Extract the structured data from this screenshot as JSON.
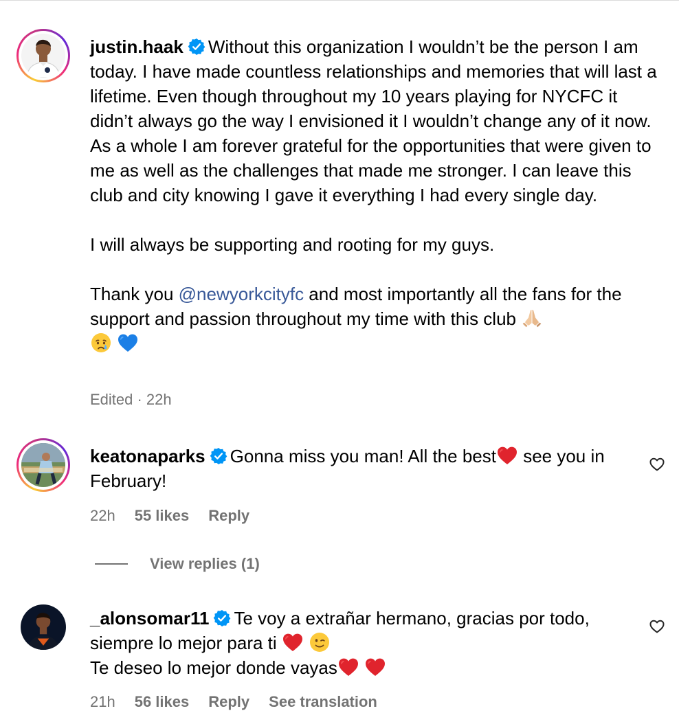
{
  "comments": [
    {
      "username": "justin.haak",
      "text_1": "Without this organization I wouldn’t be the person I am today. I have made countless relationships and memories that will last a lifetime. Even though throughout my 10 years playing for NYCFC it didn’t always go the way I envisioned it I wouldn’t change any of it now. As a whole I am forever grateful for the opportunities that were given to me as well as the challenges that made me stronger. I can leave this club and city knowing I gave it everything I had every single day.",
      "text_2": "I will always be supporting and rooting for my guys.",
      "text_3a": "Thank you ",
      "mention": "@newyorkcityfc",
      "text_3b": " and most importantly all the fans for the support and passion throughout my time with this club ",
      "meta": "Edited · 22h"
    },
    {
      "username": "keatonaparks",
      "text_a": "Gonna miss you man! All the best",
      "text_b": " see you in February!",
      "time": "22h",
      "likes": "55 likes",
      "reply": "Reply",
      "view_replies": "View replies (1)"
    },
    {
      "username": "_alonsomar11",
      "text_a": "Te voy a extrañar hermano, gracias por todo, siempre lo mejor para ti ",
      "text_b": "Te deseo lo mejor donde vayas",
      "time": "21h",
      "likes": "56 likes",
      "reply": "Reply",
      "see_translation": "See translation"
    }
  ],
  "icons": {
    "verified": "verified-badge-icon",
    "heart": "heart-outline-icon",
    "praying_hands": "praying-hands-emoji",
    "crying_face": "crying-face-emoji",
    "blue_heart": "blue-heart-emoji",
    "red_heart": "red-heart-emoji",
    "winking_face": "winking-face-emoji"
  },
  "colors": {
    "verified_blue": "#0095f6",
    "mention_blue": "#385898",
    "meta_gray": "#737373"
  }
}
